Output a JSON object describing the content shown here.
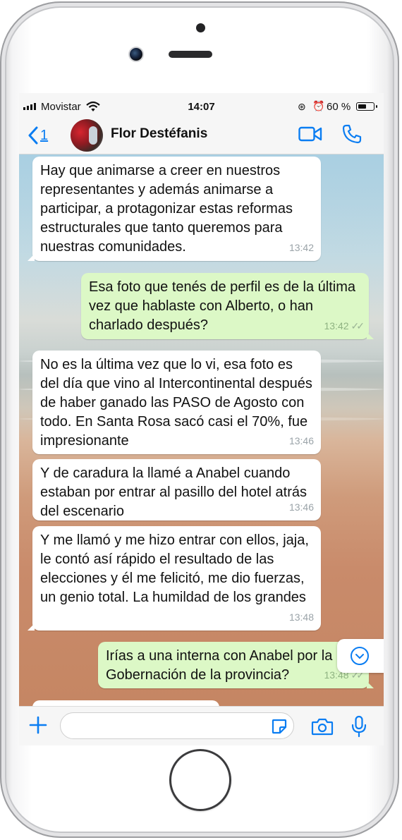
{
  "status": {
    "carrier": "Movistar",
    "time": "14:07",
    "battery_percent": "60 %",
    "battery_level": 0.6,
    "icons": [
      "signal-icon",
      "wifi-icon",
      "rotation-lock-icon",
      "alarm-icon",
      "battery-icon"
    ]
  },
  "header": {
    "back_count": "1",
    "contact_name": "Flor Destéfanis",
    "icons": [
      "back-chevron-icon",
      "video-call-icon",
      "phone-call-icon"
    ],
    "accent_color": "#0a7df2"
  },
  "messages": [
    {
      "direction": "in",
      "text": "Hay que animarse a creer en nuestros representantes y además animarse a participar, a protagonizar estas reformas estructurales que tanto queremos para nuestras comunidades.",
      "time": "13:42"
    },
    {
      "direction": "out",
      "text": "Esa foto que tenés de perfil es de la última vez que hablaste con Alberto, o han charlado después?",
      "time": "13:42",
      "ticks": "✓✓"
    },
    {
      "direction": "in",
      "text": "No es la última vez que lo vi, esa foto es del día que vino al Intercontinental después de haber ganado las PASO de Agosto con todo. En Santa Rosa sacó casi el 70%, fue impresionante",
      "time": "13:46"
    },
    {
      "direction": "in",
      "text": "Y de caradura la llamé a Anabel cuando estaban por entrar al pasillo del hotel atrás del escenario",
      "time": "13:46"
    },
    {
      "direction": "in",
      "text": "Y me llamó y me hizo entrar con ellos, jaja, le contó así rápido el resultado de las elecciones y él me felicitó, me dio fuerzas, un genio total. La humildad de los grandes",
      "time": "13:48"
    },
    {
      "direction": "out",
      "text": "Irías a una interna con Anabel por la Gobernación de la provincia?",
      "time": "13:48",
      "ticks": "✓✓"
    }
  ],
  "input": {
    "placeholder": "",
    "icons": [
      "plus-icon",
      "sticker-icon",
      "camera-icon",
      "microphone-icon"
    ]
  },
  "colors": {
    "incoming_bubble": "#ffffff",
    "outgoing_bubble": "#dcf8c6",
    "timestamp": "#9aa3a8"
  }
}
